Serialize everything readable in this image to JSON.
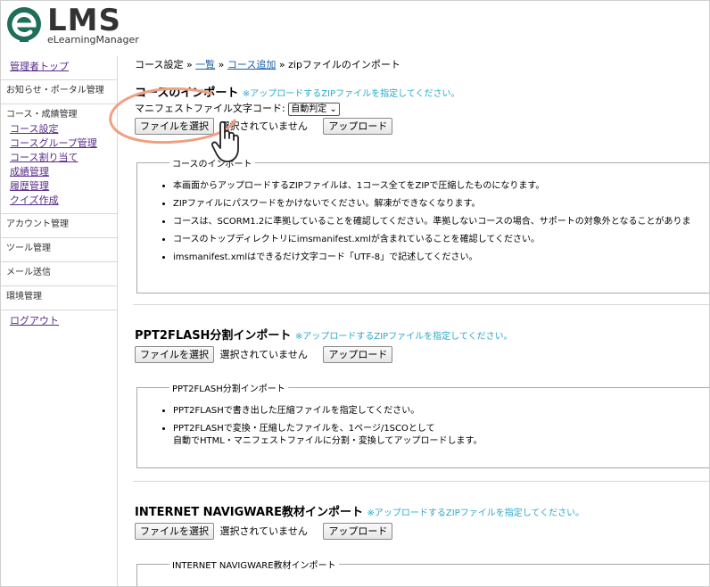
{
  "header": {
    "logo_letter": "e",
    "logo_text": "LMS",
    "logo_sub": "eLearningManager"
  },
  "sidebar": {
    "admin_top": "管理者トップ",
    "notice": "お知らせ・ポータル管理",
    "course_head": "コース・成績管理",
    "course_items": [
      "コース設定",
      "コースグループ管理",
      "コース割り当て",
      "成績管理",
      "履歴管理",
      "クイズ作成"
    ],
    "account": "アカウント管理",
    "tools": "ツール管理",
    "mail": "メール送信",
    "env": "環境管理",
    "logout": "ログアウト"
  },
  "breadcrumb": {
    "root": "コース設定",
    "sep": " » ",
    "list": "一覧",
    "add": "コース追加",
    "current": "zipファイルのインポート"
  },
  "course_import": {
    "title": "コースのインポート",
    "note": "※アップロードするZIPファイルを指定してください。",
    "manifest_label": "マニフェストファイル文字コード:",
    "manifest_value": "自動判定",
    "choose_label": "ファイルを選択",
    "no_file": "選択されていません",
    "upload_label": "アップロード",
    "legend": "コースのインポート",
    "items": [
      "本画面からアップロードするZIPファイルは、1コース全てをZIPで圧縮したものになります。",
      "ZIPファイルにパスワードをかけないでください。解凍ができなくなります。",
      "コースは、SCORM1.2に準拠していることを確認してください。準拠しないコースの場合、サポートの対象外となることがありま",
      "コースのトップディレクトリにimsmanifest.xmlが含まれていることを確認してください。",
      "imsmanifest.xmlはできるだけ文字コード「UTF-8」で記述してください。"
    ]
  },
  "ppt_import": {
    "title": "PPT2FLASH分割インポート",
    "note": "※アップロードするZIPファイルを指定してください。",
    "choose_label": "ファイルを選択",
    "no_file": "選択されていません",
    "upload_label": "アップロード",
    "legend": "PPT2FLASH分割インポート",
    "item1": "PPT2FLASHで書き出した圧縮ファイルを指定してください。",
    "item2_line1": "PPT2FLASHで変換・圧縮したファイルを、1ページ/1SCOとして",
    "item2_line2": "自動でHTML・マニフェストファイルに分割・変換してアップロードします。"
  },
  "navigware_import": {
    "title": "INTERNET NAVIGWARE教材インポート",
    "note": "※アップロードするZIPファイルを指定してください。",
    "choose_label": "ファイルを選択",
    "no_file": "選択されていません",
    "upload_label": "アップロード",
    "legend": "INTERNET NAVIGWARE教材インポート"
  },
  "colors": {
    "accent": "#2aa8c9",
    "logo_green": "#1f6e5a",
    "link": "#5a2d8a",
    "highlight": "#f0a080"
  }
}
